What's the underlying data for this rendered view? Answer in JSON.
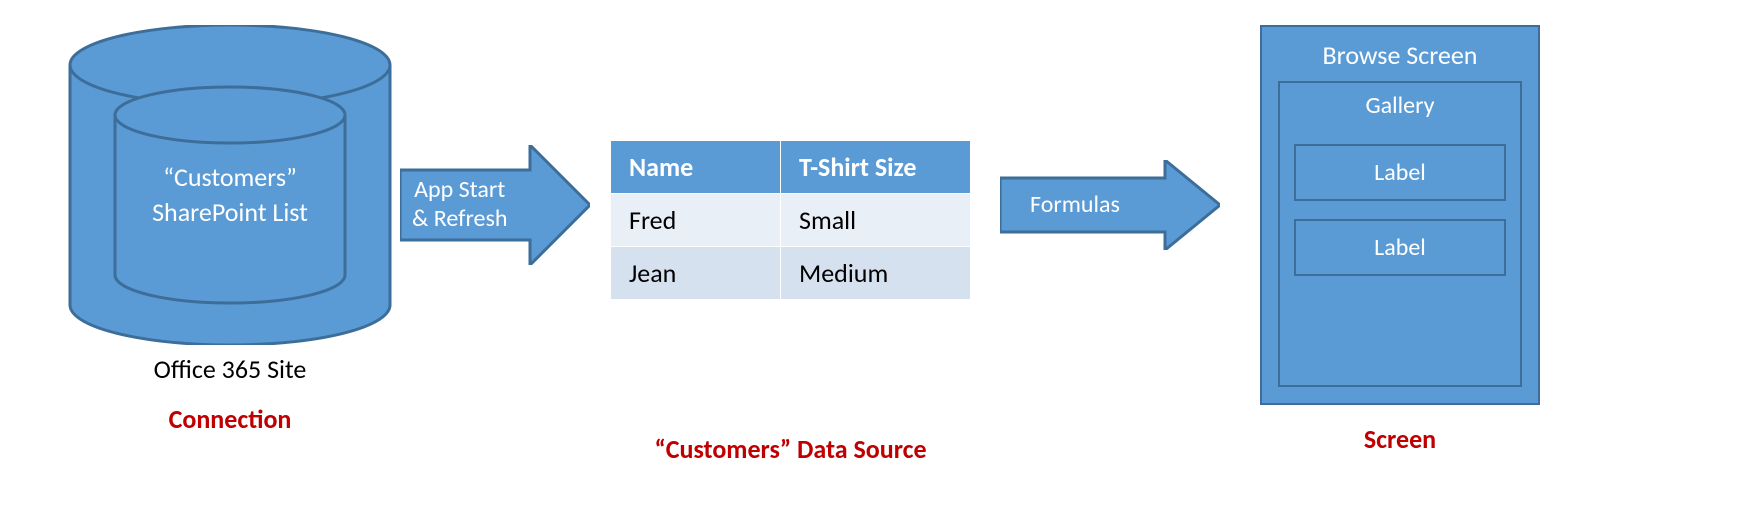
{
  "connection": {
    "inner_label_line1": "“Customers”",
    "inner_label_line2": "SharePoint List",
    "outer_label": "Office 365 Site",
    "caption": "Connection"
  },
  "arrow1": {
    "label_line1": "App Start",
    "label_line2": "& Refresh"
  },
  "datasource": {
    "columns": [
      "Name",
      "T-Shirt Size"
    ],
    "rows": [
      {
        "name": "Fred",
        "size": "Small"
      },
      {
        "name": "Jean",
        "size": "Medium"
      }
    ],
    "caption": "“Customers” Data Source"
  },
  "arrow2": {
    "label": "Formulas"
  },
  "screen": {
    "title": "Browse Screen",
    "gallery_title": "Gallery",
    "label1": "Label",
    "label2": "Label",
    "caption": "Screen"
  },
  "colors": {
    "primary": "#5b9bd5",
    "primary_border": "#3d6e9a",
    "accent_red": "#c00000"
  }
}
